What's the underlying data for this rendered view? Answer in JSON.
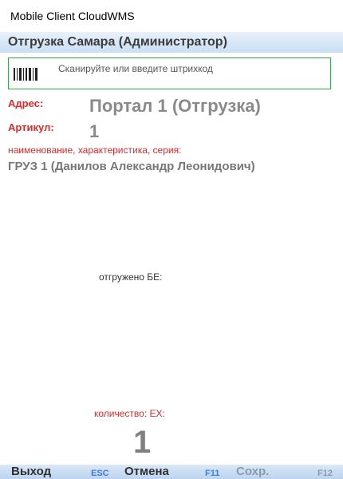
{
  "window": {
    "title": "Mobile Client CloudWMS"
  },
  "header": {
    "title": "Отгрузка Самара (Администратор)"
  },
  "scan": {
    "placeholder": "Сканируйте или введите штрихкод",
    "value": ""
  },
  "fields": {
    "address_label": "Адрес:",
    "address_value": "Портал 1 (Отгрузка)",
    "article_label": "Артикул:",
    "article_value": "1",
    "description_label": "наименование,  характеристика, серия:",
    "description_value": "ГРУЗ 1 (Данилов Александр Леонидович)",
    "shipped_label": "отгружено  БЕ:",
    "quantity_label": "количество:  ЕХ:",
    "quantity_value": "1"
  },
  "footer": {
    "exit_label": "Выход",
    "exit_key": "ESC",
    "cancel_label": "Отмена",
    "cancel_key": "F11",
    "save_label": "Сохр.",
    "save_key": "F12"
  },
  "icons": {
    "scan": "barcode-icon"
  },
  "colors": {
    "accent_red": "#e32727",
    "border_green": "#36a84a",
    "fkey_blue": "#3d7fd6"
  }
}
